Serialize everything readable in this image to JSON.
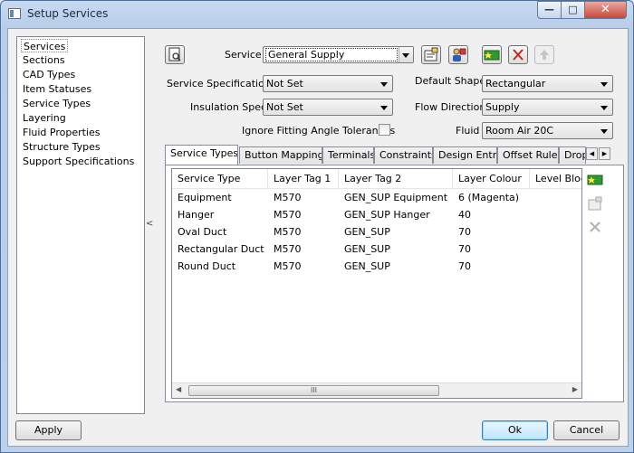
{
  "window": {
    "title": "Setup Services",
    "controls": {
      "minimize": "—",
      "maximize": "□",
      "close": "✕"
    }
  },
  "nav": {
    "items": [
      {
        "label": "Services",
        "selected": true
      },
      {
        "label": "Sections"
      },
      {
        "label": "CAD Types"
      },
      {
        "label": "Item Statuses"
      },
      {
        "label": "Service Types"
      },
      {
        "label": "Layering"
      },
      {
        "label": "Fluid Properties"
      },
      {
        "label": "Structure Types"
      },
      {
        "label": "Support Specifications"
      }
    ],
    "collapse_glyph": "<"
  },
  "form": {
    "service_label": "Service",
    "service_value": "General Supply",
    "service_spec_label": "Service Specification",
    "service_spec_value": "Not Set",
    "insulation_spec_label": "Insulation Spec",
    "insulation_spec_value": "Not Set",
    "ignore_fitting_label": "Ignore Fitting Angle Tolerances",
    "ignore_fitting_checked": false,
    "default_shape_label": "Default Shape",
    "default_shape_value": "Rectangular",
    "flow_direction_label": "Flow Direction",
    "flow_direction_value": "Supply",
    "fluid_label": "Fluid",
    "fluid_value": "Room Air 20C"
  },
  "tabs": [
    {
      "label": "Service Types",
      "active": true
    },
    {
      "label": "Button Mappings"
    },
    {
      "label": "Terminals"
    },
    {
      "label": "Constraints"
    },
    {
      "label": "Design Entry"
    },
    {
      "label": "Offset Rules"
    },
    {
      "label": "Drop"
    }
  ],
  "table": {
    "columns": [
      "Service Type",
      "Layer Tag 1",
      "Layer Tag 2",
      "Layer Colour",
      "Level Bloc"
    ],
    "rows": [
      [
        "Equipment",
        "M570",
        "GEN_SUP Equipment",
        "6 (Magenta)",
        ""
      ],
      [
        "Hanger",
        "M570",
        "GEN_SUP Hanger",
        "40",
        ""
      ],
      [
        "Oval Duct",
        "M570",
        "GEN_SUP",
        "70",
        ""
      ],
      [
        "Rectangular Duct",
        "M570",
        "GEN_SUP",
        "70",
        ""
      ],
      [
        "Round Duct",
        "M570",
        "GEN_SUP",
        "70",
        ""
      ]
    ],
    "scroll_grip": "III"
  },
  "buttons": {
    "apply": "Apply",
    "ok": "Ok",
    "cancel": "Cancel"
  },
  "colors": {
    "accent": "#3c7fb1",
    "close_red": "#c9483a",
    "delete_red": "#c0281e",
    "add_green": "#2e9a2e"
  }
}
